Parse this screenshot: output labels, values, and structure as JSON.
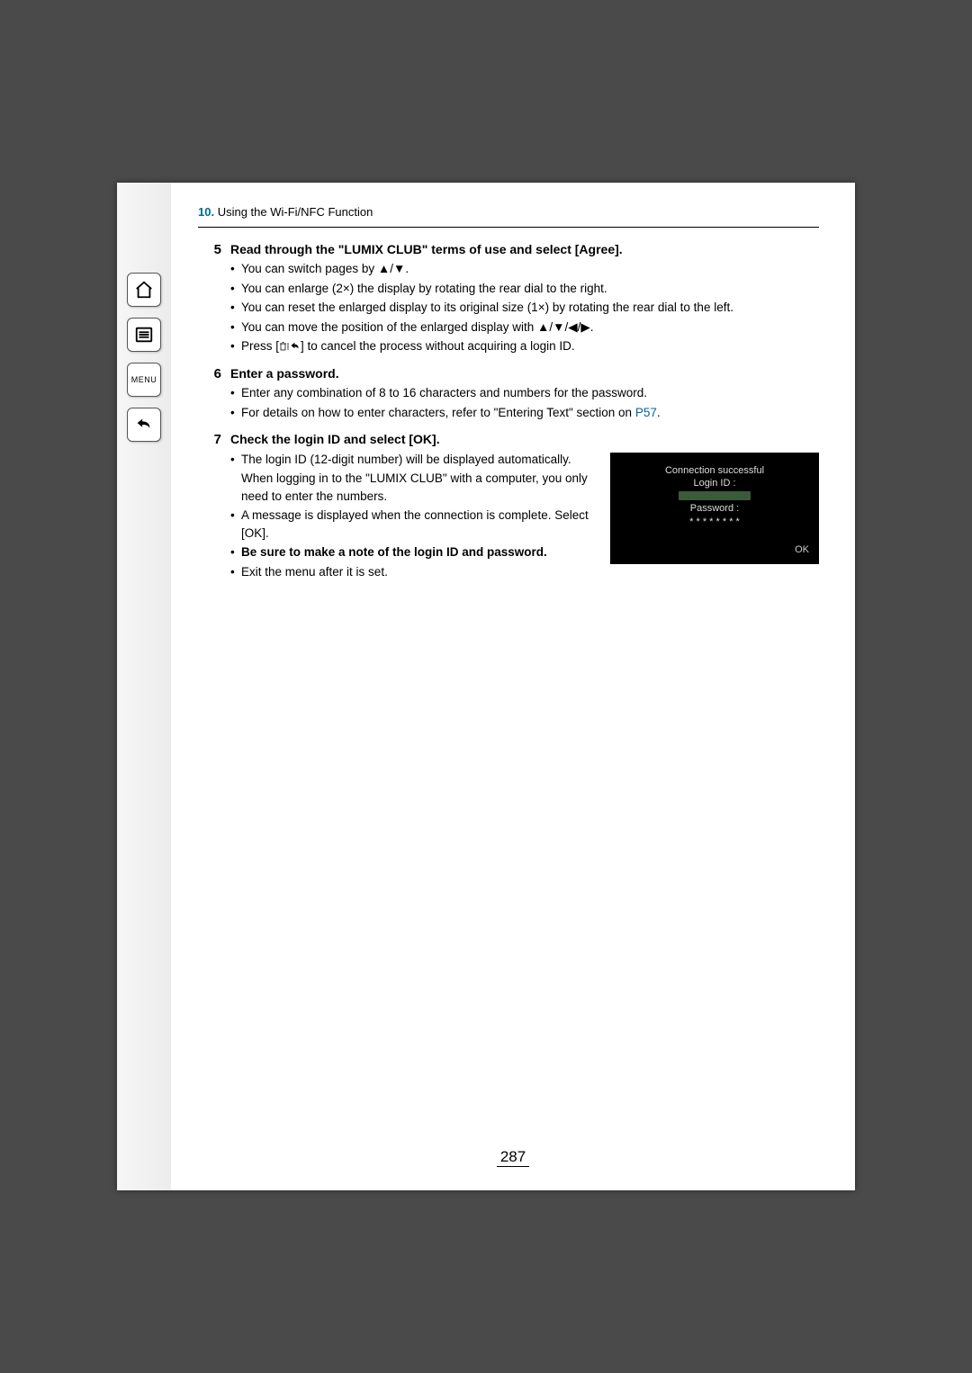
{
  "sidebar": {
    "home_label": "home",
    "toc_label": "table of contents",
    "menu_label": "MENU",
    "back_label": "back"
  },
  "header": {
    "section_number": "10.",
    "section_title": " Using the Wi-Fi/NFC Function"
  },
  "steps": {
    "s5": {
      "num": "5",
      "title": "Read through the \"LUMIX CLUB\" terms of use and select [Agree].",
      "b1a": "You can switch pages by ",
      "b1b": "▲/▼",
      "b1c": ".",
      "b2a": "You can enlarge (2",
      "b2b": "×",
      "b2c": ") the display by rotating the rear dial to the right.",
      "b3a": "You can reset the enlarged display to its original size (1",
      "b3b": "×",
      "b3c": ") by rotating the rear dial to the left.",
      "b4a": "You can move the position of the enlarged display with ",
      "b4b": "▲/▼/◀/▶",
      "b4c": ".",
      "b5a": "Press [",
      "b5b": "] to cancel the process without acquiring a login ID."
    },
    "s6": {
      "num": "6",
      "title": "Enter a password.",
      "b1": "Enter any combination of 8 to 16 characters and numbers for the password.",
      "b2a": "For details on how to enter characters, refer to \"Entering Text\" section on ",
      "b2link": "P57",
      "b2b": "."
    },
    "s7": {
      "num": "7",
      "title": "Check the login ID and select [OK].",
      "b1": "The login ID (12-digit number) will be displayed automatically.",
      "b1_extra": "When logging in to the \"LUMIX CLUB\" with a computer, you only need to enter the numbers.",
      "b2": "A message is displayed when the connection is complete. Select [OK].",
      "b3": "Be sure to make a note of the login ID and password.",
      "b4": "Exit the menu after it is set."
    }
  },
  "screenshot": {
    "line1": "Connection successful",
    "line2": "Login ID :",
    "line3": "Password :",
    "dots": "* * * * * * * *",
    "ok": "OK"
  },
  "page_number": "287"
}
